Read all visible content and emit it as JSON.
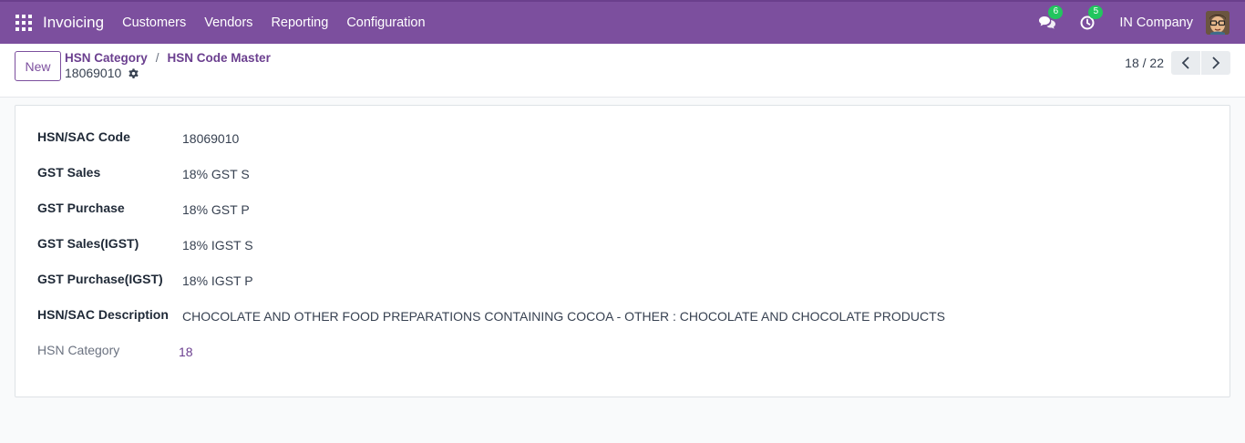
{
  "topbar": {
    "app_name": "Invoicing",
    "menu": [
      "Customers",
      "Vendors",
      "Reporting",
      "Configuration"
    ],
    "messages_count": "6",
    "activities_count": "5",
    "company": "IN Company",
    "brand_color": "#7c4f9e"
  },
  "control": {
    "new_label": "New",
    "breadcrumb": [
      "HSN Category",
      "HSN Code Master"
    ],
    "breadcrumb_sep": "/",
    "record_name": "18069010",
    "pager": "18 / 22"
  },
  "form": {
    "fields": [
      {
        "label": "HSN/SAC Code",
        "value": "18069010"
      },
      {
        "label": "GST Sales",
        "value": "18% GST S"
      },
      {
        "label": "GST Purchase",
        "value": "18% GST P"
      },
      {
        "label": "GST Sales(IGST)",
        "value": "18% IGST S"
      },
      {
        "label": "GST Purchase(IGST)",
        "value": "18% IGST P"
      },
      {
        "label": "HSN/SAC Description",
        "value": "CHOCOLATE AND OTHER FOOD PREPARATIONS CONTAINING COCOA - OTHER : CHOCOLATE AND CHOCOLATE PRODUCTS"
      },
      {
        "label": "HSN Category",
        "value": "18"
      }
    ]
  }
}
